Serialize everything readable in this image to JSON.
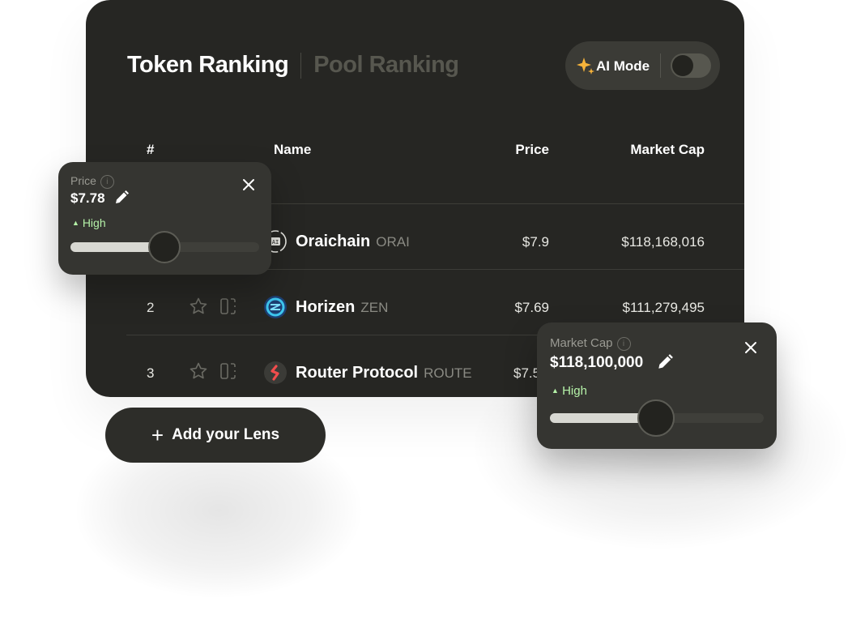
{
  "tabs": {
    "token": "Token Ranking",
    "pool": "Pool Ranking"
  },
  "ai_mode": {
    "label": "AI Mode",
    "enabled": false
  },
  "table": {
    "headers": {
      "rank": "#",
      "name": "Name",
      "price": "Price",
      "market_cap": "Market Cap"
    },
    "rows": [
      {
        "rank": "",
        "name": "Oraichain",
        "symbol": "ORAI",
        "price": "$7.9",
        "market_cap": "$118,168,016"
      },
      {
        "rank": "2",
        "name": "Horizen",
        "symbol": "ZEN",
        "price": "$7.69",
        "market_cap": "$111,279,495"
      },
      {
        "rank": "3",
        "name": "Router Protocol",
        "symbol": "ROUTE",
        "price": "$7.5",
        "market_cap": ""
      }
    ]
  },
  "add_lens": {
    "label": "Add your Lens"
  },
  "price_popup": {
    "label": "Price",
    "value": "$7.78",
    "direction": "High",
    "fill_percent": 46
  },
  "mcap_popup": {
    "label": "Market Cap",
    "value": "$118,100,000",
    "direction": "High",
    "fill_percent": 50
  }
}
